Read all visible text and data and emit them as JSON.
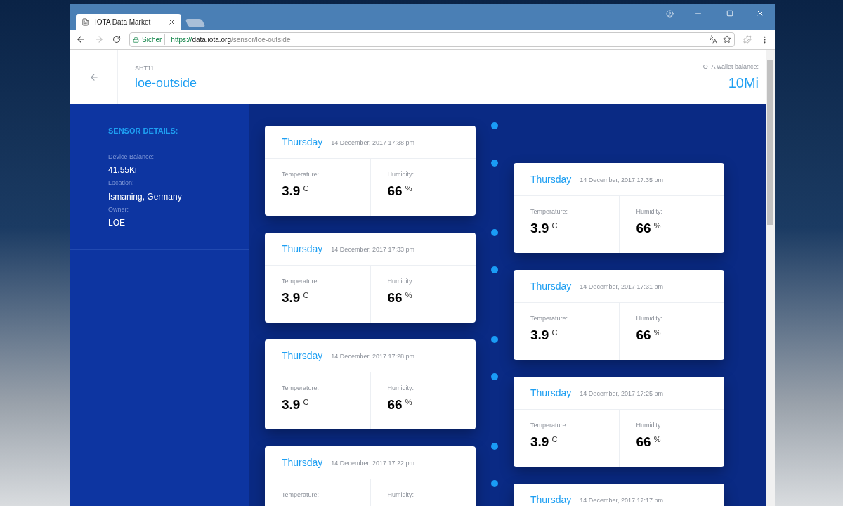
{
  "browser": {
    "tab_title": "IOTA Data Market",
    "security_label": "Sicher",
    "url": {
      "scheme": "https://",
      "host": "data.iota.org",
      "path": "/sensor/loe-outside"
    }
  },
  "header": {
    "sensor_type": "SHT11",
    "sensor_name": "loe-outside",
    "wallet_label": "IOTA wallet balance:",
    "wallet_balance": "10Mi"
  },
  "sidebar": {
    "title": "SENSOR DETAILS:",
    "fields": [
      {
        "label": "Device Balance:",
        "value": "41.55Ki"
      },
      {
        "label": "Location:",
        "value": "Ismaning, Germany"
      },
      {
        "label": "Owner:",
        "value": "LOE"
      }
    ]
  },
  "timeline": {
    "left_column": [
      {
        "day": "Thursday",
        "date": "14 December, 2017 17:38 pm",
        "temperature_label": "Temperature:",
        "temperature": "3.9",
        "temperature_unit": "C",
        "humidity_label": "Humidity:",
        "humidity": "66",
        "humidity_unit": "%"
      },
      {
        "day": "Thursday",
        "date": "14 December, 2017 17:33 pm",
        "temperature_label": "Temperature:",
        "temperature": "3.9",
        "temperature_unit": "C",
        "humidity_label": "Humidity:",
        "humidity": "66",
        "humidity_unit": "%"
      },
      {
        "day": "Thursday",
        "date": "14 December, 2017 17:28 pm",
        "temperature_label": "Temperature:",
        "temperature": "3.9",
        "temperature_unit": "C",
        "humidity_label": "Humidity:",
        "humidity": "66",
        "humidity_unit": "%"
      },
      {
        "day": "Thursday",
        "date": "14 December, 2017 17:22 pm",
        "temperature_label": "Temperature:",
        "humidity_label": "Humidity:"
      }
    ],
    "right_column": [
      {
        "day": "Thursday",
        "date": "14 December, 2017 17:35 pm",
        "temperature_label": "Temperature:",
        "temperature": "3.9",
        "temperature_unit": "C",
        "humidity_label": "Humidity:",
        "humidity": "66",
        "humidity_unit": "%"
      },
      {
        "day": "Thursday",
        "date": "14 December, 2017 17:31 pm",
        "temperature_label": "Temperature:",
        "temperature": "3.9",
        "temperature_unit": "C",
        "humidity_label": "Humidity:",
        "humidity": "66",
        "humidity_unit": "%"
      },
      {
        "day": "Thursday",
        "date": "14 December, 2017 17:25 pm",
        "temperature_label": "Temperature:",
        "temperature": "3.9",
        "temperature_unit": "C",
        "humidity_label": "Humidity:",
        "humidity": "66",
        "humidity_unit": "%"
      },
      {
        "day": "Thursday",
        "date": "14 December, 2017 17:17 pm"
      }
    ]
  }
}
